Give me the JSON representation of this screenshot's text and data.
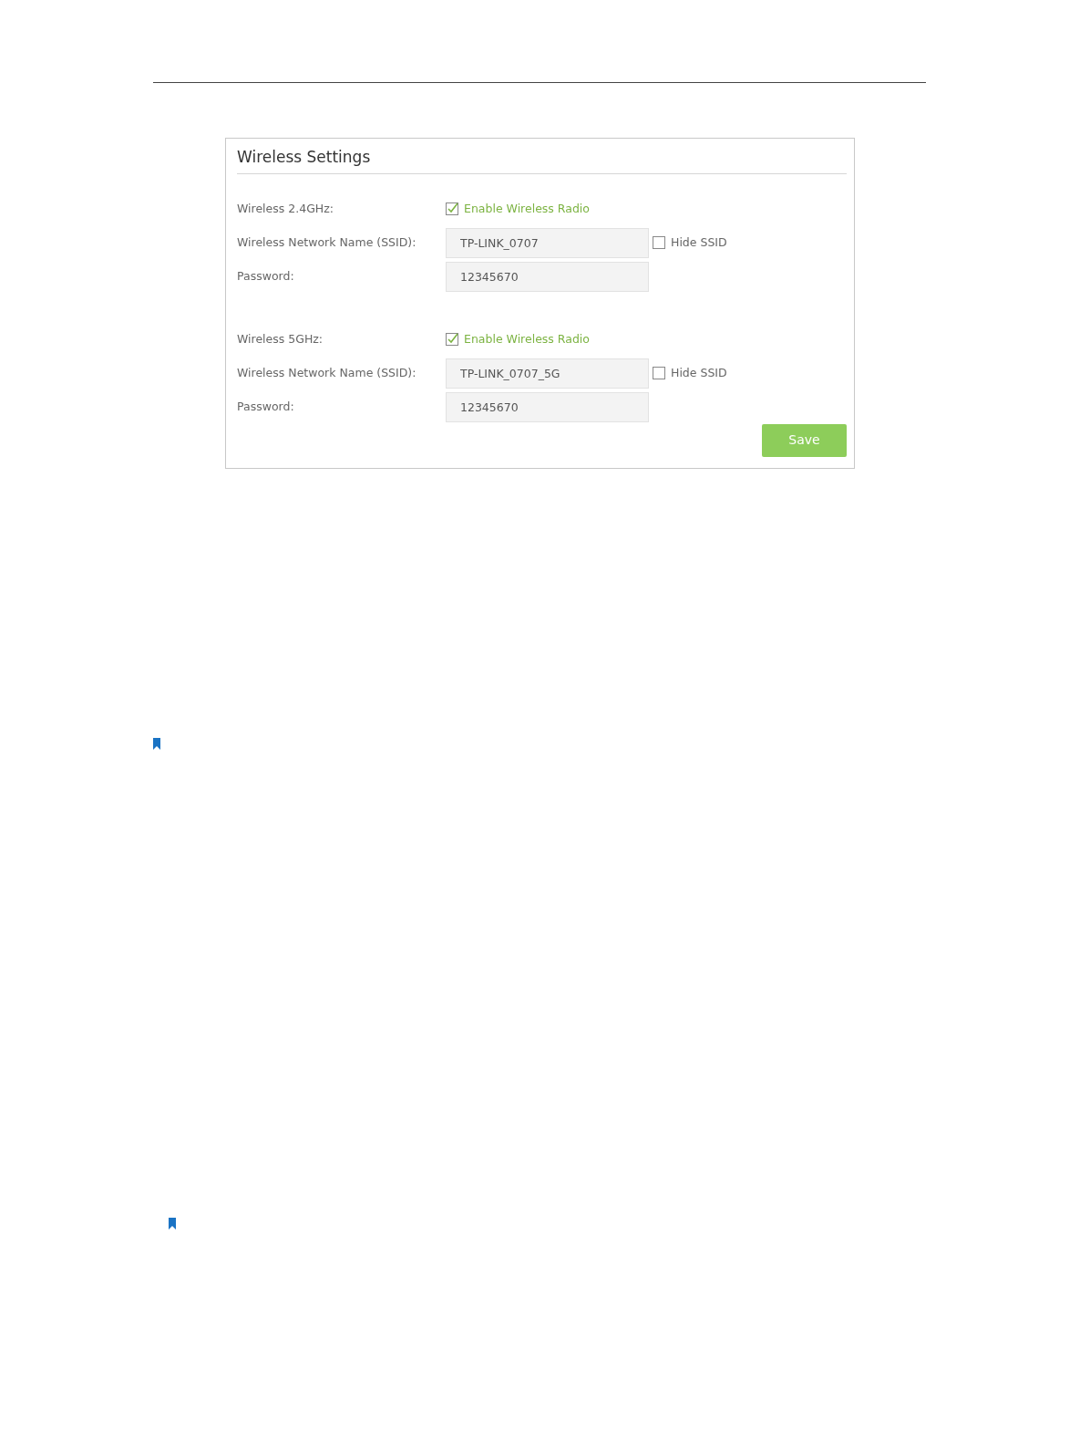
{
  "panel": {
    "title": "Wireless Settings"
  },
  "bands": [
    {
      "label": "Wireless 2.4GHz:",
      "enable": {
        "label": "Enable Wireless Radio",
        "checked": true
      },
      "ssid": {
        "label": "Wireless Network Name (SSID):",
        "value": "TP-LINK_0707"
      },
      "hide_ssid": {
        "label": "Hide SSID",
        "checked": false
      },
      "password": {
        "label": "Password:",
        "value": "12345670"
      }
    },
    {
      "label": "Wireless 5GHz:",
      "enable": {
        "label": "Enable Wireless Radio",
        "checked": true
      },
      "ssid": {
        "label": "Wireless Network Name (SSID):",
        "value": "TP-LINK_0707_5G"
      },
      "hide_ssid": {
        "label": "Hide SSID",
        "checked": false
      },
      "password": {
        "label": "Password:",
        "value": "12345670"
      }
    }
  ],
  "save_button": "Save"
}
